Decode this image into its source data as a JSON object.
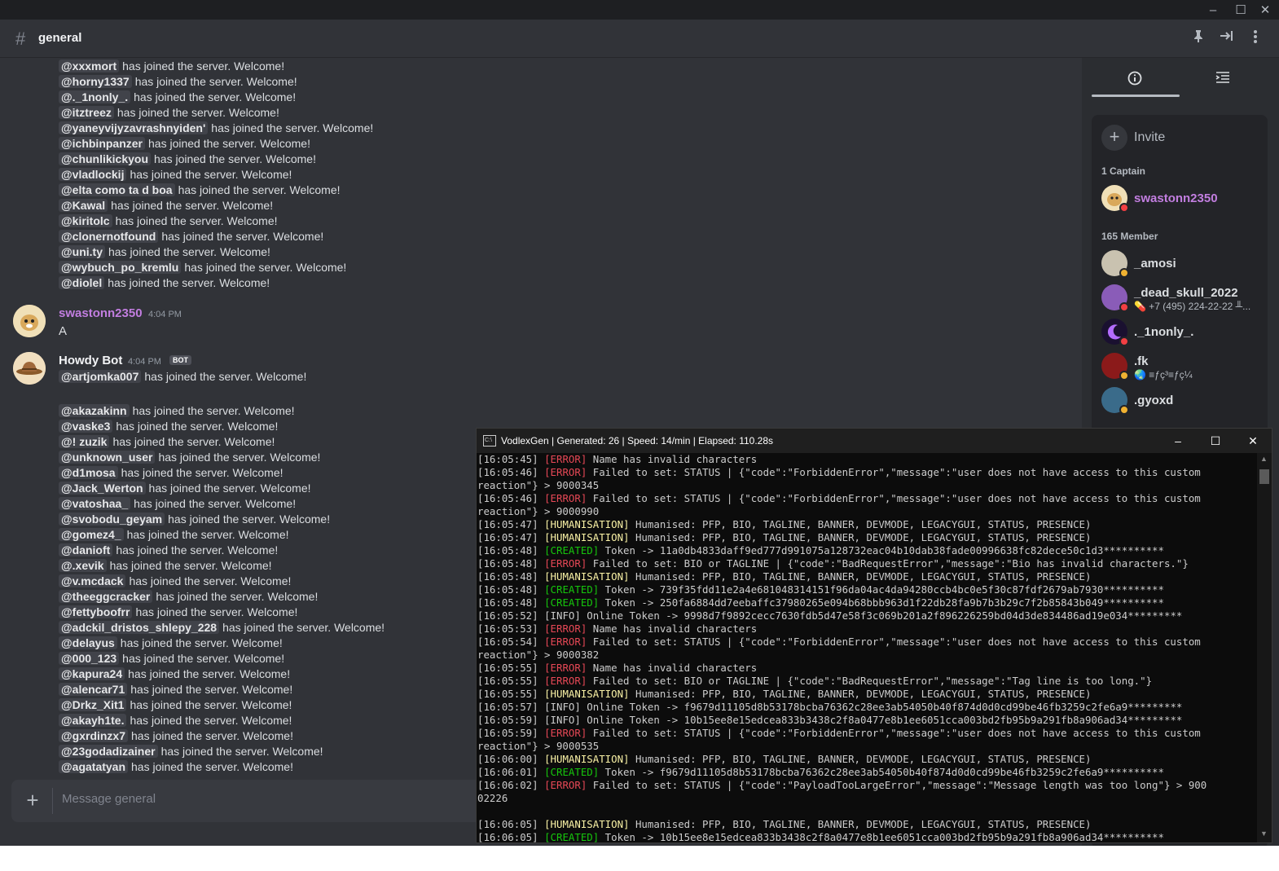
{
  "channel": {
    "name": "general",
    "hash": "#"
  },
  "window_controls": {
    "minimize": "–",
    "maximize": "☐",
    "close": "✕"
  },
  "header_icons": {
    "pin": "pin-icon",
    "members": "member-list-icon",
    "more": "more-icon"
  },
  "messages": {
    "join_suffix": "has joined the server. Welcome!",
    "top_joins": [
      "@xxxmort",
      "@horny1337",
      "@._1nonly_.",
      "@itztreez",
      "@yaneyvijyzavrashnyiden'",
      "@ichbinpanzer",
      "@chunlikickyou",
      "@vladlockij",
      "@elta como ta d boa",
      "@Kawal",
      "@kiritolc",
      "@clonernotfound",
      "@uni.ty",
      "@wybuch_po_kremlu",
      "@diolel"
    ],
    "user_message": {
      "author": "swastonn2350",
      "time": "4:04 PM",
      "text": "A",
      "author_color": "#c27ee0"
    },
    "bot_message": {
      "author": "Howdy Bot",
      "time": "4:04 PM",
      "tag": "BOT",
      "joins": [
        "@artjomka007",
        "@akazakinn",
        "@vaske3",
        "@! zuzik",
        "@unknown_user",
        "@d1mosa",
        "@Jack_Werton",
        "@vatoshaa_",
        "@svobodu_geyam",
        "@gomez4_",
        "@danioft",
        "@.xevik",
        "@v.mcdack",
        "@theeggcracker",
        "@fettyboofrr",
        "@adckil_dristos_shlepy_228",
        "@delayus",
        "@000_123",
        "@kapura24",
        "@alencar71",
        "@Drkz_Xit1",
        "@akayh1te.",
        "@gxrdinzx7",
        "@23godadizainer",
        "@agatatyan"
      ]
    }
  },
  "composer": {
    "placeholder": "Message general",
    "plus": "+"
  },
  "members_panel": {
    "invite_label": "Invite",
    "captain_heading": "1 Captain",
    "captain": {
      "name": "swastonn2350",
      "color": "#c27ee0"
    },
    "member_heading": "165 Member",
    "members": [
      {
        "name": "_amosi",
        "sub": ""
      },
      {
        "name": "_dead_skull_2022",
        "sub": "💊 +7 (495) 224-22-22 ╨..."
      },
      {
        "name": "._1nonly_.",
        "sub": ""
      },
      {
        "name": ".fk",
        "sub": "🌏 ≡ƒç³≡ƒç¼"
      },
      {
        "name": ".gyoxd",
        "sub": ""
      }
    ]
  },
  "console": {
    "title": "VodlexGen | Generated: 26 | Speed: 14/min | Elapsed: 110.28s",
    "icon_label": "C:\\",
    "lines": [
      {
        "time": "[16:05:45]",
        "tag": "[ERROR]",
        "type": "error",
        "text": " Name has invalid characters"
      },
      {
        "time": "[16:05:46]",
        "tag": "[ERROR]",
        "type": "error",
        "text": " Failed to set: STATUS | {\"code\":\"ForbiddenError\",\"message\":\"user does not have access to this custom"
      },
      {
        "time": "",
        "tag": "",
        "type": "plain",
        "text": "reaction\"} > 9000345"
      },
      {
        "time": "[16:05:46]",
        "tag": "[ERROR]",
        "type": "error",
        "text": " Failed to set: STATUS | {\"code\":\"ForbiddenError\",\"message\":\"user does not have access to this custom"
      },
      {
        "time": "",
        "tag": "",
        "type": "plain",
        "text": "reaction\"} > 9000990"
      },
      {
        "time": "[16:05:47]",
        "tag": "[HUMANISATION]",
        "type": "human",
        "text": " Humanised: PFP, BIO, TAGLINE, BANNER, DEVMODE, LEGACYGUI, STATUS, PRESENCE)"
      },
      {
        "time": "[16:05:47]",
        "tag": "[HUMANISATION]",
        "type": "human",
        "text": " Humanised: PFP, BIO, TAGLINE, BANNER, DEVMODE, LEGACYGUI, STATUS, PRESENCE)"
      },
      {
        "time": "[16:05:48]",
        "tag": "[CREATED]",
        "type": "created",
        "text": " Token -> 11a0db4833daff9ed777d991075a128732eac04b10dab38fade00996638fc82dece50c1d3**********"
      },
      {
        "time": "[16:05:48]",
        "tag": "[ERROR]",
        "type": "error",
        "text": " Failed to set: BIO or TAGLINE | {\"code\":\"BadRequestError\",\"message\":\"Bio has invalid characters.\"}"
      },
      {
        "time": "[16:05:48]",
        "tag": "[HUMANISATION]",
        "type": "human",
        "text": " Humanised: PFP, BIO, TAGLINE, BANNER, DEVMODE, LEGACYGUI, STATUS, PRESENCE)"
      },
      {
        "time": "[16:05:48]",
        "tag": "[CREATED]",
        "type": "created",
        "text": " Token -> 739f35fdd11e2a4e681048314151f96da04ac4da94280ccb4bc0e5f30c87fdf2679ab7930**********"
      },
      {
        "time": "[16:05:48]",
        "tag": "[CREATED]",
        "type": "created",
        "text": " Token -> 250fa6884dd7eebaffc37980265e094b68bbb963d1f22db28fa9b7b3b29c7f2b85843b049**********"
      },
      {
        "time": "[16:05:52]",
        "tag": "[INFO]",
        "type": "info",
        "text": " Online Token -> 9998d7f9892cecc7630fdb5d47e58f3c069b201a2f896226259bd04d3de834486ad19e034*********"
      },
      {
        "time": "[16:05:53]",
        "tag": "[ERROR]",
        "type": "error",
        "text": " Name has invalid characters"
      },
      {
        "time": "[16:05:54]",
        "tag": "[ERROR]",
        "type": "error",
        "text": " Failed to set: STATUS | {\"code\":\"ForbiddenError\",\"message\":\"user does not have access to this custom"
      },
      {
        "time": "",
        "tag": "",
        "type": "plain",
        "text": "reaction\"} > 9000382"
      },
      {
        "time": "[16:05:55]",
        "tag": "[ERROR]",
        "type": "error",
        "text": " Name has invalid characters"
      },
      {
        "time": "[16:05:55]",
        "tag": "[ERROR]",
        "type": "error",
        "text": " Failed to set: BIO or TAGLINE | {\"code\":\"BadRequestError\",\"message\":\"Tag line is too long.\"}"
      },
      {
        "time": "[16:05:55]",
        "tag": "[HUMANISATION]",
        "type": "human",
        "text": " Humanised: PFP, BIO, TAGLINE, BANNER, DEVMODE, LEGACYGUI, STATUS, PRESENCE)"
      },
      {
        "time": "[16:05:57]",
        "tag": "[INFO]",
        "type": "info",
        "text": " Online Token -> f9679d11105d8b53178bcba76362c28ee3ab54050b40f874d0d0cd99be46fb3259c2fe6a9*********"
      },
      {
        "time": "[16:05:59]",
        "tag": "[INFO]",
        "type": "info",
        "text": " Online Token -> 10b15ee8e15edcea833b3438c2f8a0477e8b1ee6051cca003bd2fb95b9a291fb8a906ad34*********"
      },
      {
        "time": "[16:05:59]",
        "tag": "[ERROR]",
        "type": "error",
        "text": " Failed to set: STATUS | {\"code\":\"ForbiddenError\",\"message\":\"user does not have access to this custom"
      },
      {
        "time": "",
        "tag": "",
        "type": "plain",
        "text": "reaction\"} > 9000535"
      },
      {
        "time": "[16:06:00]",
        "tag": "[HUMANISATION]",
        "type": "human",
        "text": " Humanised: PFP, BIO, TAGLINE, BANNER, DEVMODE, LEGACYGUI, STATUS, PRESENCE)"
      },
      {
        "time": "[16:06:01]",
        "tag": "[CREATED]",
        "type": "created",
        "text": " Token -> f9679d11105d8b53178bcba76362c28ee3ab54050b40f874d0d0cd99be46fb3259c2fe6a9**********"
      },
      {
        "time": "[16:06:02]",
        "tag": "[ERROR]",
        "type": "error",
        "text": " Failed to set: STATUS | {\"code\":\"PayloadTooLargeError\",\"message\":\"Message length was too long\"} > 900"
      },
      {
        "time": "",
        "tag": "",
        "type": "plain",
        "text": "02226"
      },
      {
        "time": "",
        "tag": "",
        "type": "plain",
        "text": ""
      },
      {
        "time": "[16:06:05]",
        "tag": "[HUMANISATION]",
        "type": "human",
        "text": " Humanised: PFP, BIO, TAGLINE, BANNER, DEVMODE, LEGACYGUI, STATUS, PRESENCE)"
      },
      {
        "time": "[16:06:05]",
        "tag": "[CREATED]",
        "type": "created",
        "text": " Token -> 10b15ee8e15edcea833b3438c2f8a0477e8b1ee6051cca003bd2fb95b9a291fb8a906ad34**********"
      }
    ]
  },
  "colors": {
    "error": "#e74856",
    "humanisation": "#f9f1a5",
    "created": "#16c60c",
    "captain": "#c27ee0"
  }
}
